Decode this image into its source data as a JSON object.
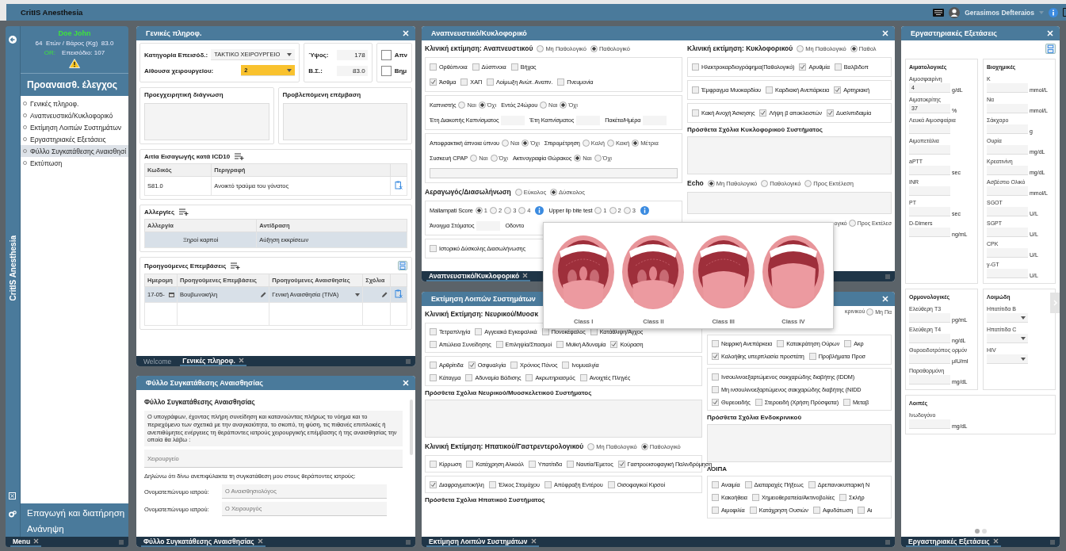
{
  "app": {
    "title": "CritIS Anesthesia",
    "user": "Gerasimos Defteraios",
    "side_title": "CritIS Anesthesia"
  },
  "patient": {
    "name": "Doe John",
    "details": "64  Ετών / Βάρος (Kg)  83.0",
    "or_label": "OR:",
    "episode": "Επεισόδιο: 107"
  },
  "menu": {
    "section": "Προαναισθ. έλεγχος",
    "items": [
      {
        "label": "Γενικές πληροφ.",
        "selected": false
      },
      {
        "label": "Αναπνευστικό/Κυκλοφορικό",
        "selected": false
      },
      {
        "label": "Εκτίμηση Λοιπών Συστημάτων",
        "selected": false
      },
      {
        "label": "Εργαστηριακές Εξετάσεις",
        "selected": false
      },
      {
        "label": "Φύλλο Συγκατάθεσης Αναισθησί",
        "selected": true
      },
      {
        "label": "Εκτύπωση",
        "selected": false
      }
    ],
    "bottom_items": [
      "Επαγωγή και διατήρηση",
      "Ανάνηψη"
    ],
    "tab": "Menu"
  },
  "general": {
    "title": "Γενικές πληροφ.",
    "fields": [
      {
        "label": "Κατηγορία Επεισόδ.:",
        "value": "ΤΑΚΤΙΚΟ ΧΕΙΡΟΥΡΓΕΙΟ",
        "highlighted": false
      },
      {
        "label": "Αίθουσα χειρουργείου:",
        "value": "2",
        "highlighted": true
      }
    ],
    "measures": [
      {
        "label": "Ύψος:",
        "value": "178"
      },
      {
        "label": "Β.Σ.:",
        "value": "83.0"
      }
    ],
    "checks": [
      {
        "label": "Απν",
        "checked": false
      },
      {
        "label": "Βημ",
        "checked": false
      }
    ],
    "textareas": [
      "Προεγχειρητική διάγνωση",
      "Προβλεπόμενη επέμβαση"
    ],
    "icd": {
      "title": "Αιτία Εισαγωγής κατά ICD10",
      "columns": [
        "Κωδικός",
        "Περιγραφή"
      ],
      "rows": [
        {
          "cells": [
            "S81.0",
            "Ανοικτό τραύμα του γόνατος"
          ],
          "selected": false
        }
      ]
    },
    "allergies": {
      "title": "Αλλεργίες",
      "columns": [
        "Αλλεργία",
        "Αντίδραση"
      ],
      "rows": [
        {
          "cells": [
            "Ξηροί καρποί",
            "Αύξηση εκκρίσεων"
          ],
          "selected": true
        }
      ]
    },
    "previous": {
      "title": "Προηγούμενες Επεμβάσεις",
      "columns": [
        "Ημερομη",
        "Προηγούμενες Επεμβάσεις",
        "Προηγούμενες Αναισθησίες",
        "Σχόλια"
      ],
      "rows": [
        {
          "date": "17-05-",
          "operation": "Βουβωνοκήλη",
          "anesthesia": "Γενική Αναισθησία (TIVA)",
          "selected": true
        }
      ]
    },
    "tabs": [
      {
        "label": "Welcome",
        "selected": false
      },
      {
        "label": "Γενικές πληροφ.",
        "selected": true
      }
    ]
  },
  "consent": {
    "title": "Φύλλο Συγκατάθεσης Αναισθησίας",
    "heading": "Φύλλο Συγκατάθεσης Αναισθησίας",
    "statement": "Ο υπογράφων, έχοντας πλήρη συνείδηση και κατανοώντας πλήρως το νόημα και το περιεχόμενο των σχετικά με την αναγκαιότητα, το σκοπό, τη φύση, τις πιθανές επιπλοκές ή ανεπιθύμητες ενέργειες τη θεράποντες ιατρούς χειρουργικής επέμβασης ή της αναισθησίας την οποία θα λάβω :",
    "room_placeholder": "Χειρουργείο",
    "declaration": "Δηλώνω ότι δίνω ανεπιφύλακτα τη συγκατάθεση μου στους θεράποντες ιατρούς:",
    "doctors": [
      {
        "label": "Ονοματεπώνυμο ιατρού:",
        "placeholder": "Ο Αναισθησιολόγος"
      },
      {
        "label": "Ονοματεπώνυμο ιατρού:",
        "placeholder": "Ο Χειρουργός"
      }
    ],
    "tab": "Φύλλο Συγκατάθεσης Αναισθησίας"
  },
  "resp": {
    "title": "Αναπνευστικό/Κυκλοφορικό",
    "tab": "Αναπνευστικό/Κυκλοφορικό",
    "left": [
      {
        "kind": "radio_heading",
        "title": "Κλινική εκτίμηση: Αναπνευστικού",
        "options": [
          {
            "label": "Μη Παθολογικό",
            "selected": false
          },
          {
            "label": "Παθολογικό",
            "selected": true
          }
        ]
      },
      {
        "kind": "group",
        "rows": [
          [
            {
              "kind": "check",
              "label": "Ορθόπνοια",
              "checked": false
            },
            {
              "kind": "check",
              "label": "Δύσπνοια",
              "checked": false
            },
            {
              "kind": "check",
              "label": "Βήχας",
              "checked": false
            }
          ],
          [
            {
              "kind": "check",
              "label": "Άσθμα",
              "checked": true
            },
            {
              "kind": "check",
              "label": "ΧΑΠ",
              "checked": false
            },
            {
              "kind": "check",
              "label": "Λοίμωξη Ανώτ. Αναπν.",
              "checked": false
            },
            {
              "kind": "check",
              "label": "Πνευμονία",
              "checked": false
            }
          ]
        ]
      },
      {
        "kind": "group",
        "rows": [
          [
            {
              "kind": "radio",
              "label": "Καπνιστής",
              "options": [
                {
                  "label": "Ναι",
                  "selected": false
                },
                {
                  "label": "Όχι",
                  "selected": true
                }
              ]
            },
            {
              "kind": "radio",
              "label": "Εντός 24ώρου",
              "options": [
                {
                  "label": "Ναι",
                  "selected": false
                },
                {
                  "label": "Όχι",
                  "selected": true
                }
              ]
            }
          ],
          [
            {
              "kind": "input",
              "label": "Έτη Διακοπής Καπνίσματος"
            },
            {
              "kind": "input",
              "label": "Έτη Καπνίσματος"
            },
            {
              "kind": "input",
              "label": "Πακέτα/Ημέρα"
            }
          ]
        ]
      },
      {
        "kind": "group",
        "rows": [
          [
            {
              "kind": "radio",
              "label": "Αποφρακτική άπνοια ύπνου",
              "options": [
                {
                  "label": "Ναι",
                  "selected": false
                },
                {
                  "label": "Όχι",
                  "selected": true
                }
              ]
            },
            {
              "kind": "radio",
              "label": "Σπιρομέτρηση",
              "options": [
                {
                  "label": "Καλή",
                  "selected": false
                },
                {
                  "label": "Κακή",
                  "selected": false
                },
                {
                  "label": "Μέτρια",
                  "selected": true
                }
              ]
            }
          ],
          [
            {
              "kind": "radio",
              "label": "Συσκευή CPAP",
              "options": [
                {
                  "label": "Ναι",
                  "selected": false
                },
                {
                  "label": "Όχι",
                  "selected": false
                }
              ]
            },
            {
              "kind": "radio",
              "label": "Ακτινογραφία Θώρακος",
              "options": [
                {
                  "label": "Ναι",
                  "selected": true
                },
                {
                  "label": "Όχι",
                  "selected": false
                }
              ]
            }
          ],
          [
            {
              "kind": "field"
            }
          ]
        ]
      },
      {
        "kind": "radio_heading",
        "title": "Αεραγωγός/Διασωλήνωση",
        "options": [
          {
            "label": "Εύκολος",
            "selected": false
          },
          {
            "label": "Δύσκολος",
            "selected": true
          }
        ]
      },
      {
        "kind": "group",
        "rows": [
          [
            {
              "kind": "radio",
              "label": "Mallampati Score",
              "options": [
                {
                  "label": "1",
                  "selected": true
                },
                {
                  "label": "2",
                  "selected": false
                },
                {
                  "label": "3",
                  "selected": false
                },
                {
                  "label": "4",
                  "selected": false
                }
              ]
            },
            {
              "kind": "info"
            },
            {
              "kind": "radio",
              "label": "Upper lip bite test",
              "options": [
                {
                  "label": "1",
                  "selected": false
                },
                {
                  "label": "2",
                  "selected": false
                },
                {
                  "label": "3",
                  "selected": false
                }
              ]
            },
            {
              "kind": "info"
            }
          ],
          [
            {
              "kind": "input",
              "label": "Άνοιγμα Στόματος"
            },
            {
              "kind": "text",
              "label": "Οδοντο"
            }
          ]
        ]
      },
      {
        "kind": "group",
        "rows": [
          [
            {
              "kind": "check",
              "label": "Ιστορικό Δύσκολης Διασωλήνωσης",
              "checked": false
            }
          ]
        ]
      }
    ],
    "right": [
      {
        "kind": "radio_heading",
        "title": "Κλινική εκτίμηση: Κυκλοφορικού",
        "options": [
          {
            "label": "Μη Παθολογικό",
            "selected": false
          },
          {
            "label": "Παθολ",
            "selected": true
          }
        ]
      },
      {
        "kind": "group",
        "rows": [
          [
            {
              "kind": "check",
              "label": "Ηλεκτροκαρδιογράφημα(Παθολογικό)",
              "checked": false
            },
            {
              "kind": "check",
              "label": "Αρυθμία",
              "checked": true
            },
            {
              "kind": "check",
              "label": "Βαλβιδοπ",
              "checked": false
            }
          ]
        ]
      },
      {
        "kind": "group",
        "rows": [
          [
            {
              "kind": "check",
              "label": "Έμφραγμα Μυοκαρδίου",
              "checked": false
            },
            {
              "kind": "check",
              "label": "Καρδιακή Ανεπάρκεια",
              "checked": false
            },
            {
              "kind": "check",
              "label": "Αρτηριακή",
              "checked": true
            }
          ]
        ]
      },
      {
        "kind": "group",
        "rows": [
          [
            {
              "kind": "check",
              "label": "Κακή Ανοχή Άσκησης",
              "checked": false
            },
            {
              "kind": "check",
              "label": "Λήψη β αποκλειστών",
              "checked": true
            },
            {
              "kind": "check",
              "label": "Δυσλιπιδαιμία",
              "checked": true
            }
          ]
        ]
      },
      {
        "kind": "comment",
        "title": "Πρόσθετα Σχόλια Κυκλοφορικού Συστήματος"
      },
      {
        "kind": "radio_heading",
        "title": "Echo",
        "options": [
          {
            "label": "Μη Παθολογικό",
            "selected": true
          },
          {
            "label": "Παθολογικό",
            "selected": false
          },
          {
            "label": "Προς Εκτέλεση",
            "selected": false
          }
        ]
      },
      {
        "kind": "box"
      },
      {
        "kind": "partial_heading",
        "text": "ογικό",
        "options": [
          {
            "label": "Προς Εκτέλεσ",
            "selected": false
          }
        ]
      }
    ]
  },
  "other": {
    "title": "Εκτίμηση Λοιπών Συστημάτων",
    "tab": "Εκτίμηση Λοιπών Συστημάτων",
    "left": [
      {
        "kind": "radio_heading",
        "title": "Κλινική Εκτίμηση: Νευρικού/Μυοσκ"
      },
      {
        "kind": "group",
        "rows": [
          [
            {
              "kind": "check",
              "label": "Τετραπληγία",
              "checked": false
            },
            {
              "kind": "check",
              "label": "Αγγειακά Εγκεφαλικά",
              "checked": false
            },
            {
              "kind": "check",
              "label": "Πονοκέφαλος",
              "checked": false
            },
            {
              "kind": "check",
              "label": "Κατάθλιψη/Άγχος",
              "checked": false
            }
          ],
          [
            {
              "kind": "check",
              "label": "Απώλεια Συνείδησης",
              "checked": false
            },
            {
              "kind": "check",
              "label": "Επιληψία/Σπασμοί",
              "checked": false
            },
            {
              "kind": "check",
              "label": "Μυϊκή Αδυναμία",
              "checked": false
            },
            {
              "kind": "check",
              "label": "Κούραση",
              "checked": true
            }
          ]
        ]
      },
      {
        "kind": "group",
        "rows": [
          [
            {
              "kind": "check",
              "label": "Αρθρίτιδα",
              "checked": false
            },
            {
              "kind": "check",
              "label": "Οσφυαλγία",
              "checked": true
            },
            {
              "kind": "check",
              "label": "Χρόνιος Πόνος",
              "checked": false
            },
            {
              "kind": "check",
              "label": "Ινομυαλγία",
              "checked": false
            }
          ],
          [
            {
              "kind": "check",
              "label": "Κάταγμα",
              "checked": false
            },
            {
              "kind": "check",
              "label": "Αδυναμία Βάδισης",
              "checked": false
            },
            {
              "kind": "check",
              "label": "Ακρωτηριασμός",
              "checked": false
            },
            {
              "kind": "check",
              "label": "Ανοιχτές Πληγές",
              "checked": false
            }
          ]
        ]
      },
      {
        "kind": "comment",
        "title": "Πρόσθετα Σχόλια Νευρικού/Μυοσκελετικού Συστήματος"
      },
      {
        "kind": "radio_heading",
        "title": "Κλινική Εκτίμηση: Ηπατικού/Γαστρεντερολογικού",
        "options": [
          {
            "label": "Μη Παθολογικό",
            "selected": false
          },
          {
            "label": "Παθολογικό",
            "selected": true
          }
        ]
      },
      {
        "kind": "group",
        "rows": [
          [
            {
              "kind": "check",
              "label": "Κίρρωση",
              "checked": false
            },
            {
              "kind": "check",
              "label": "Κατάχρηση Αλκοόλ",
              "checked": false
            },
            {
              "kind": "check",
              "label": "Υπατίτιδα",
              "checked": false
            },
            {
              "kind": "check",
              "label": "Ναυτία/Έμετος",
              "checked": false
            },
            {
              "kind": "check",
              "label": "Γαστροοισοφαγική Παλινδρόμηση",
              "checked": true
            }
          ]
        ]
      },
      {
        "kind": "group",
        "rows": [
          [
            {
              "kind": "check",
              "label": "Διαφραγματοκήλη",
              "checked": true
            },
            {
              "kind": "check",
              "label": "Έλκος Στομάχου",
              "checked": false
            },
            {
              "kind": "check",
              "label": "Απόφραξη Εντέρου",
              "checked": false
            },
            {
              "kind": "check",
              "label": "Οισοφαγικοί Κιρσοί",
              "checked": false
            }
          ]
        ]
      },
      {
        "kind": "heading",
        "title": "Πρόσθετα Σχόλια Ηπατικού Συστήματος"
      }
    ],
    "right": [
      {
        "kind": "partial_heading",
        "text": "κρινικού",
        "options": [
          {
            "label": "Μη Πα",
            "selected": false
          }
        ]
      },
      {
        "kind": "group",
        "rows": [
          [
            {
              "kind": "check",
              "label": "Νεφρική Ανεπάρκεια",
              "checked": false
            },
            {
              "kind": "check",
              "label": "Κατακράτηση Ούρων",
              "checked": false
            },
            {
              "kind": "check",
              "label": "Ακρ",
              "checked": false
            }
          ],
          [
            {
              "kind": "check",
              "label": "Καλοήθης υπερπλασία προστάτη",
              "checked": true
            },
            {
              "kind": "check",
              "label": "Προβλήματα Προσ",
              "checked": false
            }
          ]
        ]
      },
      {
        "kind": "group",
        "rows": [
          [
            {
              "kind": "check",
              "label": "Ινσουλινοεξαρτώμενος σακχαρώδης διαβήτης (IDDM)",
              "checked": false
            }
          ],
          [
            {
              "kind": "check",
              "label": "Μη ινσουλινοεξαρτώμενος σακχαρώδης διαβήτης (NIDD",
              "checked": false
            }
          ],
          [
            {
              "kind": "check",
              "label": "Θυρεοειδής",
              "checked": true
            },
            {
              "kind": "check",
              "label": "Στεροειδή (Χρήση Πρόσφατα)",
              "checked": false
            },
            {
              "kind": "check",
              "label": "Μεταβ",
              "checked": false
            }
          ]
        ]
      },
      {
        "kind": "comment",
        "title": "Πρόσθετα Σχόλια Ενδοκρινικού"
      },
      {
        "kind": "heading",
        "title": "ΛΟΙΠΑ"
      },
      {
        "kind": "group",
        "rows": [
          [
            {
              "kind": "check",
              "label": "Αναιμία",
              "checked": false
            },
            {
              "kind": "check",
              "label": "Διαταραχές Πήξεως",
              "checked": false
            },
            {
              "kind": "check",
              "label": "Δρεπανοκυτταρική Ν",
              "checked": false
            }
          ],
          [
            {
              "kind": "check",
              "label": "Κακοήθεια",
              "checked": false
            },
            {
              "kind": "check",
              "label": "Χημειοθεραπεία/Ακτινοβολίες",
              "checked": false
            },
            {
              "kind": "check",
              "label": "Σκλήρ",
              "checked": false
            }
          ],
          [
            {
              "kind": "check",
              "label": "Αιμοφιλία",
              "checked": false
            },
            {
              "kind": "check",
              "label": "Κατάχρηση Ουσιών",
              "checked": false
            },
            {
              "kind": "check",
              "label": "Αφυδάτωση",
              "checked": false
            },
            {
              "kind": "check",
              "label": "Αι",
              "checked": false
            }
          ]
        ]
      }
    ]
  },
  "mallampati_popup": {
    "classes": [
      "Class I",
      "Class II",
      "Class III",
      "Class IV"
    ]
  },
  "labs": {
    "title": "Εργαστηριακές Εξετάσεις",
    "tab": "Εργαστηριακές Εξετάσεις",
    "groups": [
      {
        "title": "Αιματολογικές",
        "tests": [
          {
            "kind": "input",
            "label": "Αιμοσφαιρίνη",
            "value": "4",
            "unit": "g/dL"
          },
          {
            "kind": "input",
            "label": "Αιματοκρίτης",
            "value": "37",
            "unit": "%"
          },
          {
            "kind": "input",
            "label": "Λευκά Αιμοσφαίρια"
          },
          {
            "kind": "input",
            "label": "Αιμοπετάλια"
          },
          {
            "kind": "input",
            "label": "aPTT",
            "unit": "sec"
          },
          {
            "kind": "input",
            "label": "INR"
          },
          {
            "kind": "input",
            "label": "PT",
            "unit": "sec"
          },
          {
            "kind": "input",
            "label": "D-Dimers",
            "unit": "ng/mL"
          }
        ]
      },
      {
        "title": "Βιοχημικές",
        "tests": [
          {
            "kind": "input",
            "label": "K",
            "unit": "mmol/L"
          },
          {
            "kind": "input",
            "label": "Να",
            "unit": "mmol/L"
          },
          {
            "kind": "input",
            "label": "Σάκχαρο",
            "unit": "g"
          },
          {
            "kind": "input",
            "label": "Ουρία",
            "unit": "mg/dL"
          },
          {
            "kind": "input",
            "label": "Κρεατινίνη",
            "unit": "mg/dL"
          },
          {
            "kind": "input",
            "label": "Ασβέστιο Ολικό",
            "unit": "mmol/L"
          },
          {
            "kind": "input",
            "label": "SGOT",
            "unit": "U/L"
          },
          {
            "kind": "input",
            "label": "SGPT",
            "unit": "U/L"
          },
          {
            "kind": "input",
            "label": "CPK",
            "unit": "U/L"
          },
          {
            "kind": "input",
            "label": "γ-GT",
            "unit": "U/L"
          }
        ]
      },
      {
        "title": "Ορμονολογικές",
        "tests": [
          {
            "kind": "input",
            "label": "Ελεύθερη T3",
            "unit": "pg/mL"
          },
          {
            "kind": "input",
            "label": "Ελεύθερη T4",
            "unit": "ng/dL"
          },
          {
            "kind": "input",
            "label": "Θυροειδοτρόπος ορμόν",
            "unit": "μIU/ml"
          },
          {
            "kind": "input",
            "label": "Παραθορμόνη",
            "unit": "mg/dL"
          }
        ]
      },
      {
        "title": "Λοιμώδη",
        "tests": [
          {
            "kind": "select",
            "label": "Ηπατίτιδα B"
          },
          {
            "kind": "select",
            "label": "Ηπατίτιδα C"
          },
          {
            "kind": "select",
            "label": "HIV"
          }
        ]
      },
      {
        "title": "Λοιπές",
        "tests": [
          {
            "kind": "input",
            "label": "Ινωδογόνο",
            "unit": "mg/dL"
          }
        ]
      }
    ],
    "pages": [
      {
        "selected": true
      },
      {
        "selected": false
      }
    ]
  }
}
